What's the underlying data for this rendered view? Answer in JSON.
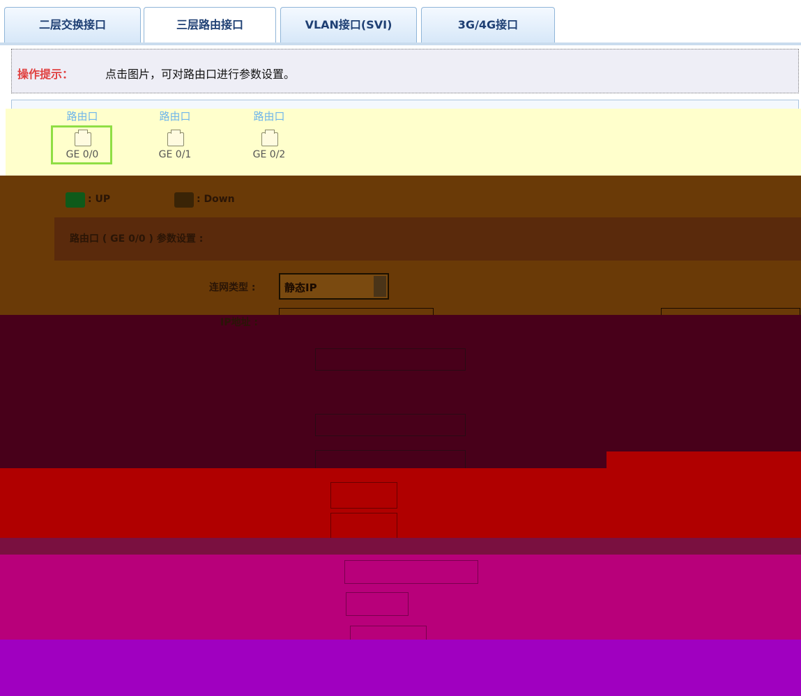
{
  "tabs": [
    {
      "label": "二层交换接口"
    },
    {
      "label": "三层路由接口"
    },
    {
      "label": "VLAN接口(SVI)"
    },
    {
      "label": "3G/4G接口"
    }
  ],
  "hint": {
    "label": "操作提示：",
    "text": "点击图片，可对路由口进行参数设置。"
  },
  "ports": [
    {
      "type": "路由口",
      "name": "GE 0/0"
    },
    {
      "type": "路由口",
      "name": "GE 0/1"
    },
    {
      "type": "路由口",
      "name": "GE 0/2"
    }
  ],
  "legend": {
    "up": ": UP",
    "down": ": Down"
  },
  "section": {
    "title": "路由口 ( GE 0/0 ) 参数设置 :"
  },
  "form": {
    "conn_type_label": "连网类型 :",
    "conn_type_value": "静态IP",
    "ip_label": "IP地址 :"
  },
  "colors": {
    "tab_text": "#1e3f73",
    "hint_label": "#e04040",
    "port_label": "#6fb5ea",
    "selected_border": "#8fde44"
  }
}
